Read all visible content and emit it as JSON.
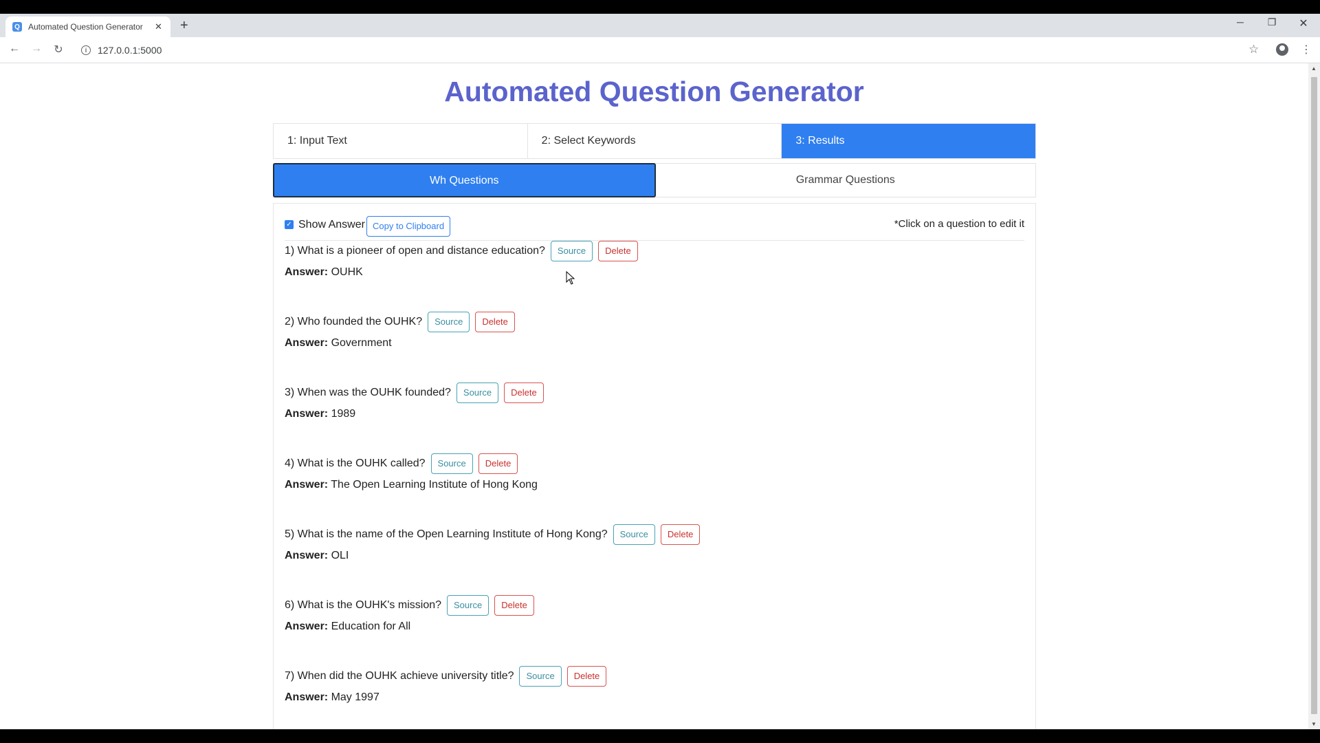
{
  "browser": {
    "tab_title": "Automated Question Generator",
    "url": "127.0.0.1:5000",
    "new_tab": "+",
    "tab_close": "✕"
  },
  "page": {
    "title": "Automated Question Generator",
    "steps": [
      {
        "label": "1: Input Text",
        "active": false
      },
      {
        "label": "2: Select Keywords",
        "active": false
      },
      {
        "label": "3: Results",
        "active": true
      }
    ],
    "question_tabs": [
      {
        "label": "Wh Questions",
        "active": true
      },
      {
        "label": "Grammar Questions",
        "active": false
      }
    ],
    "show_answer": {
      "label": "Show Answer",
      "checked": true
    },
    "copy_button": "Copy to Clipboard",
    "edit_hint": "*Click on a question to edit it",
    "source_label": "Source",
    "delete_label": "Delete",
    "answer_prefix": "Answer:",
    "questions": [
      {
        "text": "1) What is a pioneer of open and distance education?",
        "answer": "OUHK"
      },
      {
        "text": "2) Who founded the OUHK?",
        "answer": "Government"
      },
      {
        "text": "3) When was the OUHK founded?",
        "answer": "1989"
      },
      {
        "text": "4) What is the OUHK called?",
        "answer": "The Open Learning Institute of Hong Kong"
      },
      {
        "text": "5) What is the name of the Open Learning Institute of Hong Kong?",
        "answer": "OLI"
      },
      {
        "text": "6) What is the OUHK's mission?",
        "answer": "Education for All"
      },
      {
        "text": "7) When did the OUHK achieve university title?",
        "answer": "May 1997"
      }
    ]
  },
  "colors": {
    "accent": "#2f7ff0",
    "title": "#5b63cc",
    "source_button": "#48a2b5",
    "delete_button": "#d9534f"
  },
  "icons": [
    "favicon-icon",
    "close-icon",
    "back-icon",
    "forward-icon",
    "reload-icon",
    "info-icon",
    "star-icon",
    "profile-icon",
    "menu-icon",
    "cursor-icon"
  ]
}
